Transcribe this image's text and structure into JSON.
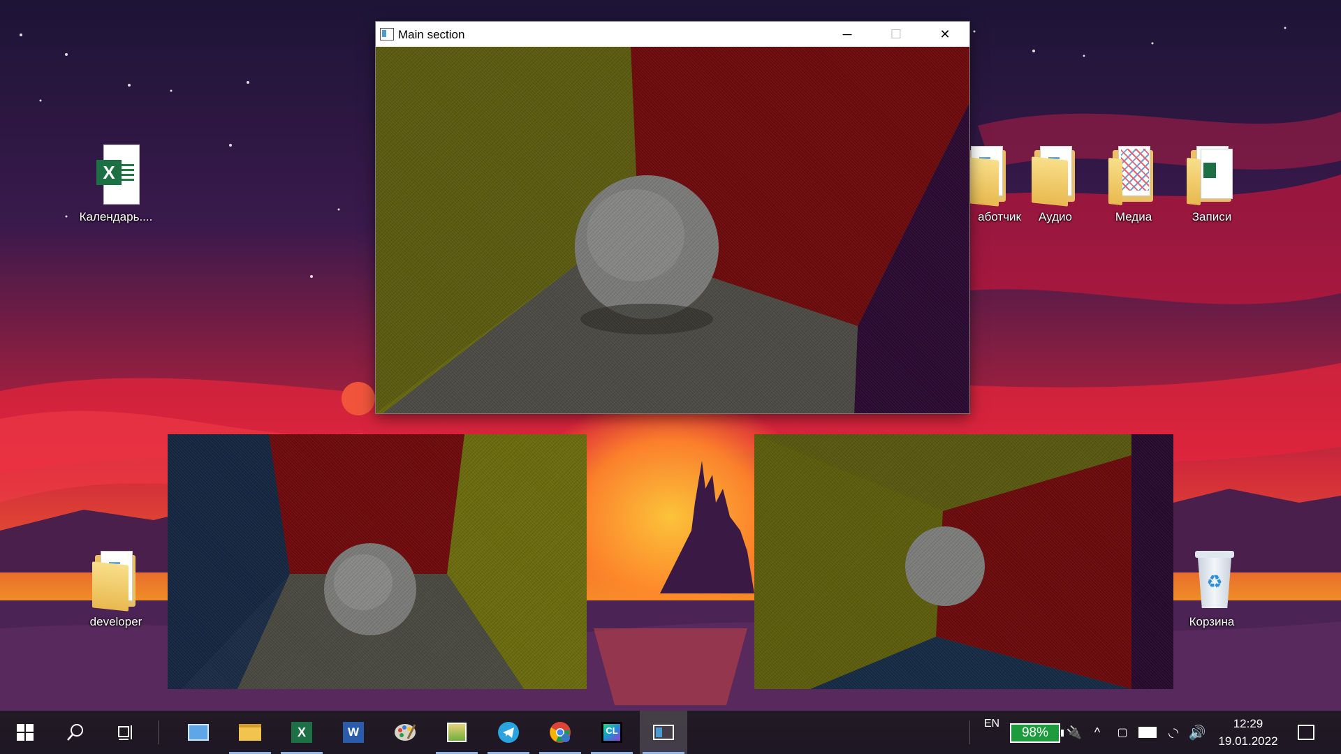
{
  "desktop": {
    "icons": [
      {
        "label": "Календарь....",
        "type": "excel-file"
      },
      {
        "label": "developer",
        "type": "folder"
      },
      {
        "label": "аботчик",
        "type": "folder"
      },
      {
        "label": "Аудио",
        "type": "folder"
      },
      {
        "label": "Медиа",
        "type": "folder"
      },
      {
        "label": "Записи",
        "type": "folder"
      },
      {
        "label": "Корзина",
        "type": "recycle-bin"
      }
    ]
  },
  "main_window": {
    "title": "Main section",
    "controls": {
      "minimize": "─",
      "maximize": "☐",
      "close": "✕"
    }
  },
  "taskbar": {
    "apps": [
      {
        "name": "start-button",
        "icon": "windows-logo-icon"
      },
      {
        "name": "search-button",
        "icon": "search-icon"
      },
      {
        "name": "task-view-button",
        "icon": "task-view-icon"
      },
      {
        "name": "control-panel",
        "icon": "control-panel-icon"
      },
      {
        "name": "file-explorer",
        "icon": "folder-icon"
      },
      {
        "name": "excel",
        "icon": "excel-icon",
        "letter": "X"
      },
      {
        "name": "word",
        "icon": "word-icon",
        "letter": "W"
      },
      {
        "name": "paint",
        "icon": "palette-icon"
      },
      {
        "name": "image-viewer",
        "icon": "image-icon"
      },
      {
        "name": "telegram",
        "icon": "telegram-icon"
      },
      {
        "name": "chrome",
        "icon": "chrome-icon"
      },
      {
        "name": "clion",
        "icon": "clion-icon",
        "letter": "CL"
      },
      {
        "name": "opengl-app",
        "icon": "window-app-icon"
      }
    ],
    "tray": {
      "language": "EN",
      "battery": "98%",
      "time": "12:29",
      "date": "19.01.2022"
    }
  },
  "colors": {
    "accent": "#8fb4e6",
    "battery_bg": "#1e9b3c"
  }
}
